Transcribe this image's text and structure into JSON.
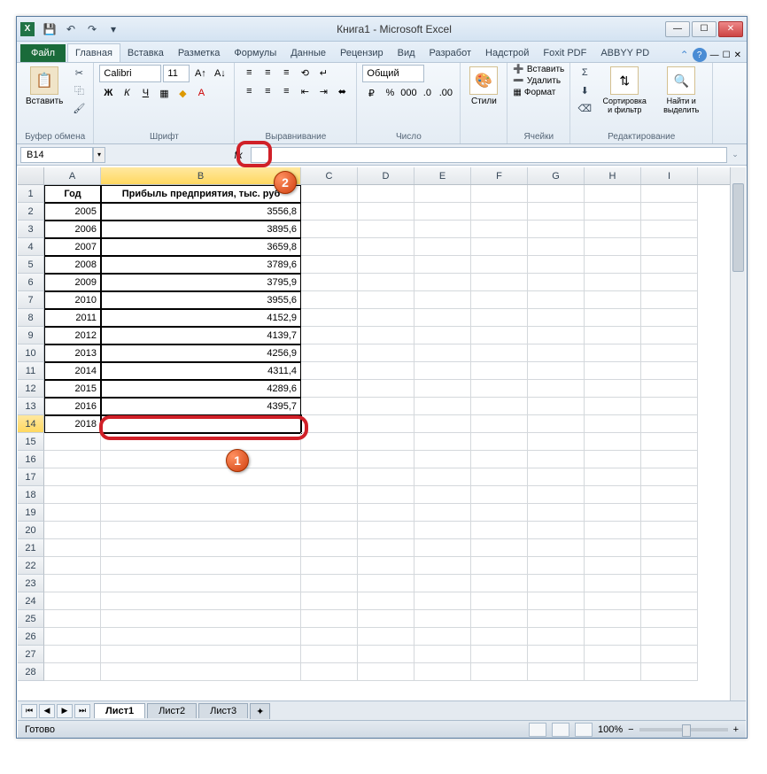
{
  "window": {
    "title": "Книга1 - Microsoft Excel"
  },
  "qat": {
    "save": "💾",
    "undo": "↶",
    "redo": "↷"
  },
  "tabs": {
    "file": "Файл",
    "items": [
      "Главная",
      "Вставка",
      "Разметка",
      "Формулы",
      "Данные",
      "Рецензир",
      "Вид",
      "Разработ",
      "Надстрой",
      "Foxit PDF",
      "ABBYY PD"
    ],
    "active": 0
  },
  "ribbon": {
    "clipboard": {
      "paste": "Вставить",
      "label": "Буфер обмена"
    },
    "font": {
      "name": "Calibri",
      "size": "11",
      "label": "Шрифт"
    },
    "align": {
      "label": "Выравнивание"
    },
    "number": {
      "format": "Общий",
      "label": "Число"
    },
    "styles": {
      "btn": "Стили"
    },
    "cells": {
      "insert": "Вставить",
      "delete": "Удалить",
      "format": "Формат",
      "label": "Ячейки"
    },
    "editing": {
      "sort": "Сортировка и фильтр",
      "find": "Найти и выделить",
      "label": "Редактирование"
    }
  },
  "formula_bar": {
    "namebox": "B14",
    "fx": "fx",
    "value": ""
  },
  "columns": [
    "A",
    "B",
    "C",
    "D",
    "E",
    "F",
    "G",
    "H",
    "I"
  ],
  "selected_col": "B",
  "selected_row": 14,
  "table": {
    "headers": {
      "A": "Год",
      "B": "Прибыль предприятия, тыс. руб"
    },
    "rows": [
      {
        "A": "2005",
        "B": "3556,8"
      },
      {
        "A": "2006",
        "B": "3895,6"
      },
      {
        "A": "2007",
        "B": "3659,8"
      },
      {
        "A": "2008",
        "B": "3789,6"
      },
      {
        "A": "2009",
        "B": "3795,9"
      },
      {
        "A": "2010",
        "B": "3955,6"
      },
      {
        "A": "2011",
        "B": "4152,9"
      },
      {
        "A": "2012",
        "B": "4139,7"
      },
      {
        "A": "2013",
        "B": "4256,9"
      },
      {
        "A": "2014",
        "B": "4311,4"
      },
      {
        "A": "2015",
        "B": "4289,6"
      },
      {
        "A": "2016",
        "B": "4395,7"
      },
      {
        "A": "2018",
        "B": ""
      }
    ]
  },
  "sheets": {
    "items": [
      "Лист1",
      "Лист2",
      "Лист3"
    ],
    "active": 0
  },
  "status": {
    "ready": "Готово",
    "zoom": "100%"
  },
  "callouts": {
    "c1": "1",
    "c2": "2"
  }
}
